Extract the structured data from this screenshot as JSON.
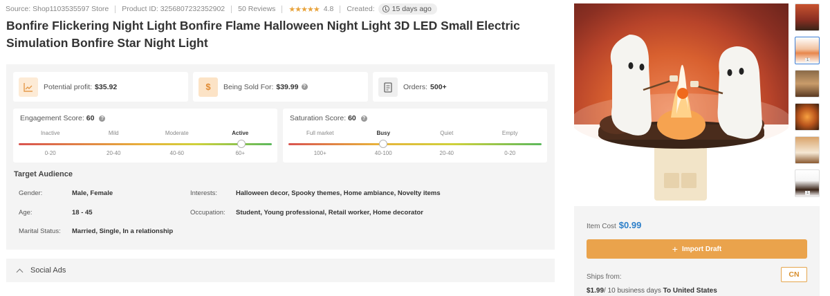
{
  "meta": {
    "source": "Source: Shop1103535597 Store",
    "product_id": "Product ID: 3256807232352902",
    "reviews": "50 Reviews",
    "stars": "★★★★★",
    "rating": "4.8",
    "created_label": "Created:",
    "created_value": "15 days ago"
  },
  "title": "Bonfire Flickering Night Light Bonfire Flame Halloween Night Light 3D LED Small Electric Simulation Bonfire Star Night Light",
  "stats": {
    "profit_label": "Potential profit:",
    "profit_value": "$35.92",
    "sold_label": "Being Sold For:",
    "sold_value": "$39.99",
    "orders_label": "Orders:",
    "orders_value": "500+"
  },
  "engagement": {
    "label": "Engagement Score:",
    "value": "60",
    "levels": [
      "Inactive",
      "Mild",
      "Moderate",
      "Active"
    ],
    "ranges": [
      "0-20",
      "20-40",
      "40-60",
      "60+"
    ],
    "marker_fraction": 0.88
  },
  "saturation": {
    "label": "Saturation Score:",
    "value": "60",
    "levels": [
      "Full market",
      "Busy",
      "Quiet",
      "Empty"
    ],
    "ranges": [
      "100+",
      "40-100",
      "20-40",
      "0-20"
    ],
    "marker_fraction": 0.375
  },
  "audience": {
    "title": "Target Audience",
    "gender_label": "Gender:",
    "gender_value": "Male, Female",
    "age_label": "Age:",
    "age_value": "18 - 45",
    "marital_label": "Marital Status:",
    "marital_value": "Married, Single, In a relationship",
    "interests_label": "Interests:",
    "interests_value": "Halloween decor, Spooky themes, Home ambiance, Novelty items",
    "occupation_label": "Occupation:",
    "occupation_value": "Student, Young professional, Retail worker, Home decorator"
  },
  "social_ads": "Social Ads",
  "purchase": {
    "cost_label": "Item Cost",
    "cost_value": "$0.99",
    "import_label": "Import Draft",
    "ships_from_label": "Ships from:",
    "country": "CN",
    "shipping_price": "$1.99",
    "shipping_days": "/ 10 business days",
    "shipping_dest": "To United States"
  },
  "thumbnail_badges": [
    "",
    "1",
    "",
    "",
    "",
    "1"
  ],
  "colors": {
    "accent_orange": "#eaa34c",
    "price_blue": "#2c7fc9",
    "panel_bg": "#f4f4f4",
    "selected_thumb_border": "#3d7fd6"
  }
}
